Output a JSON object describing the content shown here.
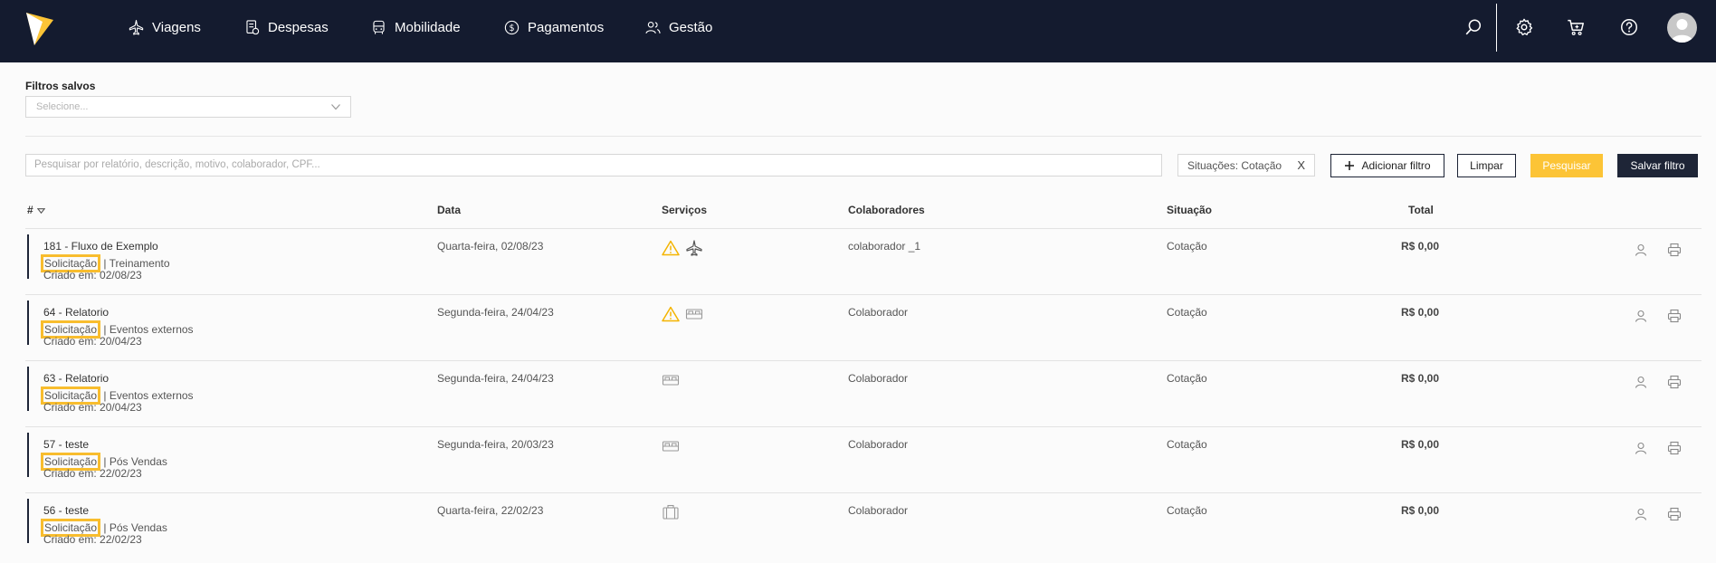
{
  "nav": {
    "items": [
      {
        "label": "Viagens"
      },
      {
        "label": "Despesas"
      },
      {
        "label": "Mobilidade"
      },
      {
        "label": "Pagamentos"
      },
      {
        "label": "Gestão"
      }
    ]
  },
  "filters": {
    "saved_label": "Filtros salvos",
    "saved_placeholder": "Selecione...",
    "search_placeholder": "Pesquisar por relatório, descrição, motivo, colaborador, CPF...",
    "chip_label": "Situações: Cotação",
    "chip_close": "X",
    "add_filter": "Adicionar filtro",
    "clear": "Limpar",
    "search": "Pesquisar",
    "save_filter": "Salvar filtro"
  },
  "table": {
    "headers": {
      "id": "#",
      "date": "Data",
      "services": "Serviços",
      "collaborators": "Colaboradores",
      "status": "Situação",
      "total": "Total"
    },
    "rows": [
      {
        "title": "181 - Fluxo de Exemplo",
        "type": "Solicitação",
        "reason": "| Treinamento",
        "created": "Criado em: 02/08/23",
        "date": "Quarta-feira, 02/08/23",
        "services": [
          "warning-icon",
          "plane-icon"
        ],
        "collaborator": "colaborador _1",
        "status": "Cotação",
        "total": "R$ 0,00"
      },
      {
        "title": "64 - Relatorio",
        "type": "Solicitação",
        "reason": "| Eventos externos",
        "created": "Criado em: 20/04/23",
        "date": "Segunda-feira, 24/04/23",
        "services": [
          "warning-icon",
          "bed-icon"
        ],
        "collaborator": "Colaborador",
        "status": "Cotação",
        "total": "R$ 0,00"
      },
      {
        "title": "63 - Relatorio",
        "type": "Solicitação",
        "reason": "| Eventos externos",
        "created": "Criado em: 20/04/23",
        "date": "Segunda-feira, 24/04/23",
        "services": [
          "bed-icon"
        ],
        "collaborator": "Colaborador",
        "status": "Cotação",
        "total": "R$ 0,00"
      },
      {
        "title": "57 - teste",
        "type": "Solicitação",
        "reason": "| Pós Vendas",
        "created": "Criado em: 22/02/23",
        "date": "Segunda-feira, 20/03/23",
        "services": [
          "bed-icon"
        ],
        "collaborator": "Colaborador",
        "status": "Cotação",
        "total": "R$ 0,00"
      },
      {
        "title": "56 - teste",
        "type": "Solicitação",
        "reason": "| Pós Vendas",
        "created": "Criado em: 22/02/23",
        "date": "Quarta-feira, 22/02/23",
        "services": [
          "luggage-icon"
        ],
        "collaborator": "Colaborador",
        "status": "Cotação",
        "total": "R$ 0,00"
      }
    ]
  },
  "colors": {
    "navbar": "#141b2f",
    "accent": "#fcc436",
    "highlight_border": "#f8bd2e",
    "dark_button": "#1e2537"
  }
}
